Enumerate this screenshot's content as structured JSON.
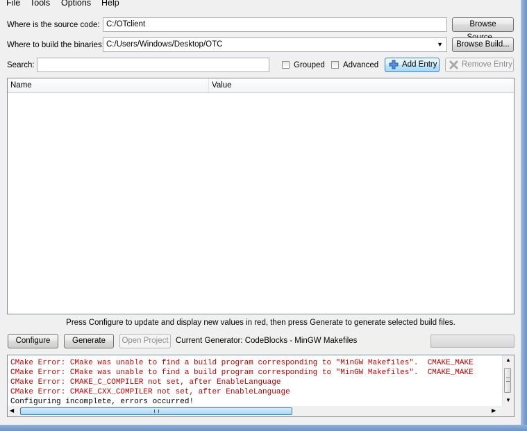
{
  "menu": [
    "File",
    "Tools",
    "Options",
    "Help"
  ],
  "source": {
    "label": "Where is the source code:",
    "value": "C:/OTclient",
    "browse_label": "Browse Source..."
  },
  "build": {
    "label": "Where to build the binaries:",
    "value": "C:/Users/Windows/Desktop/OTC",
    "browse_label": "Browse Build..."
  },
  "search": {
    "label": "Search:",
    "value": "",
    "placeholder": ""
  },
  "options": {
    "grouped_label": "Grouped",
    "grouped_checked": false,
    "advanced_label": "Advanced",
    "advanced_checked": false,
    "add_entry_label": "Add Entry",
    "remove_entry_label": "Remove Entry"
  },
  "table": {
    "columns": [
      "Name",
      "Value"
    ],
    "rows": []
  },
  "hint": "Press Configure to update and display new values in red, then press Generate to generate selected build files.",
  "actions": {
    "configure_label": "Configure",
    "generate_label": "Generate",
    "open_project_label": "Open Project",
    "generator_text": "Current Generator: CodeBlocks - MinGW Makefiles"
  },
  "progress": 0,
  "log": [
    {
      "text": "CMake Error: CMake was unable to find a build program corresponding to \"MinGW Makefiles\".  CMAKE_MAKE",
      "color": "#c00000"
    },
    {
      "text": "CMake Error: CMake was unable to find a build program corresponding to \"MinGW Makefiles\".  CMAKE_MAKE",
      "color": "#c00000"
    },
    {
      "text": "CMake Error: CMAKE_C_COMPILER not set, after EnableLanguage",
      "color": "#c00000"
    },
    {
      "text": "CMake Error: CMAKE_CXX_COMPILER not set, after EnableLanguage",
      "color": "#c00000"
    },
    {
      "text": "Configuring incomplete, errors occurred!",
      "color": "#000000"
    }
  ],
  "colors": {
    "error": "#c00000",
    "window_bg": "#f0f0f0",
    "frame": "#6e92c2"
  },
  "icons": {
    "add": "plus-icon",
    "remove": "x-icon",
    "dropdown": "chevron-down-icon"
  }
}
